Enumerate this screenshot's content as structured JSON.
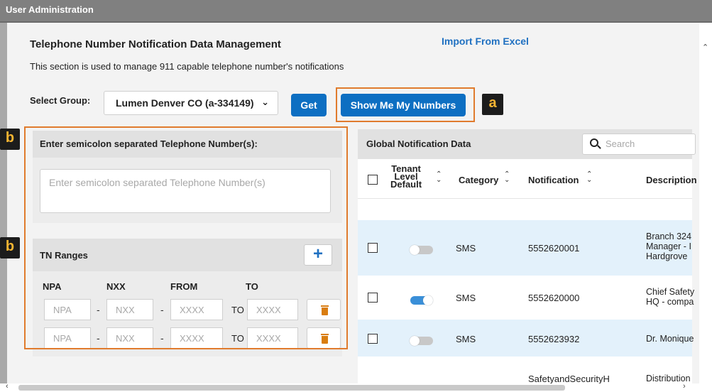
{
  "window": {
    "title": "User Administration"
  },
  "page": {
    "title": "Telephone Number Notification Data Management",
    "import_link": "Import From Excel",
    "description": "This section is used to manage 911 capable telephone number's notifications"
  },
  "group": {
    "label": "Select Group:",
    "value": "Lumen Denver CO (a-334149)",
    "get_label": "Get",
    "show_label": "Show Me My Numbers"
  },
  "callouts": {
    "a": "a",
    "b": "b"
  },
  "enter": {
    "header": "Enter semicolon separated Telephone Number(s):",
    "placeholder": "Enter semicolon separated Telephone Number(s)"
  },
  "ranges": {
    "header": "TN Ranges",
    "add_label": "+",
    "columns": [
      "NPA",
      "NXX",
      "FROM",
      "TO"
    ],
    "to_label": "TO",
    "dash": "-",
    "placeholders": {
      "npa": "NPA",
      "nxx": "NXX",
      "from": "XXXX",
      "to": "XXXX"
    }
  },
  "global": {
    "header": "Global Notification Data",
    "search_placeholder": "Search",
    "columns": {
      "tenant": [
        "Tenant",
        "Level",
        "Default"
      ],
      "category": "Category",
      "notification": "Notification",
      "description": "Description"
    },
    "rows": [
      {
        "default_on": false,
        "category": "SMS",
        "notification": "5552620001",
        "description": [
          "Branch 324",
          "Manager - I",
          "Hardgrove"
        ]
      },
      {
        "default_on": true,
        "category": "SMS",
        "notification": "5552620000",
        "description": [
          "Chief Safety",
          "HQ - compa"
        ]
      },
      {
        "default_on": false,
        "category": "SMS",
        "notification": "5552623932",
        "description": [
          "Dr. Monique"
        ]
      },
      {
        "default_on": false,
        "category": "",
        "notification": "SafetyandSecurityH",
        "description": [
          "Distribution"
        ]
      }
    ]
  },
  "colors": {
    "accent": "#0d6fc2",
    "callout_border": "#e07b2d",
    "toggle_on": "#3a8fd8",
    "toggle_off": "#c8c8c8"
  }
}
